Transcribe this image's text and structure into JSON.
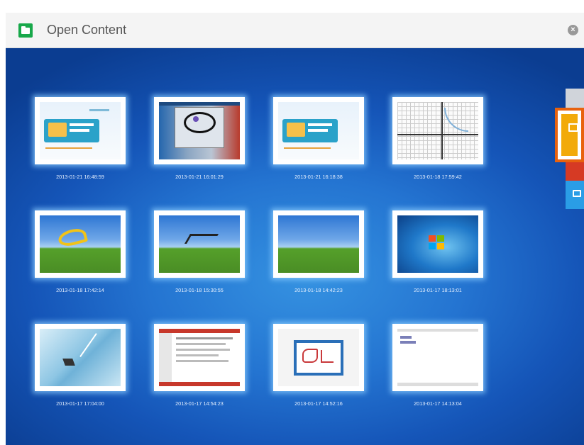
{
  "window": {
    "title": "Open Content"
  },
  "items": [
    {
      "date": "2013-01-21 16:48:59"
    },
    {
      "date": "2013-01-21 16:01:29"
    },
    {
      "date": "2013-01-21 16:18:38"
    },
    {
      "date": "2013-01-18 17:59:42"
    },
    {
      "date": "2013-01-18 17:42:14"
    },
    {
      "date": "2013-01-18 15:30:55"
    },
    {
      "date": "2013-01-18 14:42:23"
    },
    {
      "date": "2013-01-17 18:13:01"
    },
    {
      "date": "2013-01-17 17:04:00"
    },
    {
      "date": "2013-01-17 14:54:23"
    },
    {
      "date": "2013-01-17 14:52:16"
    },
    {
      "date": "2013-01-17 14:13:04"
    }
  ],
  "sidebar": {
    "icons": [
      "document-icon",
      "share-icon",
      "folder-icon",
      "image-icon"
    ],
    "colors": {
      "share": "#f2aa0a",
      "highlight": "#e8620e",
      "folder": "#d63a24",
      "image": "#2a9de6"
    }
  },
  "theme": {
    "accent": "#18a84a",
    "background": "#2474d1"
  }
}
